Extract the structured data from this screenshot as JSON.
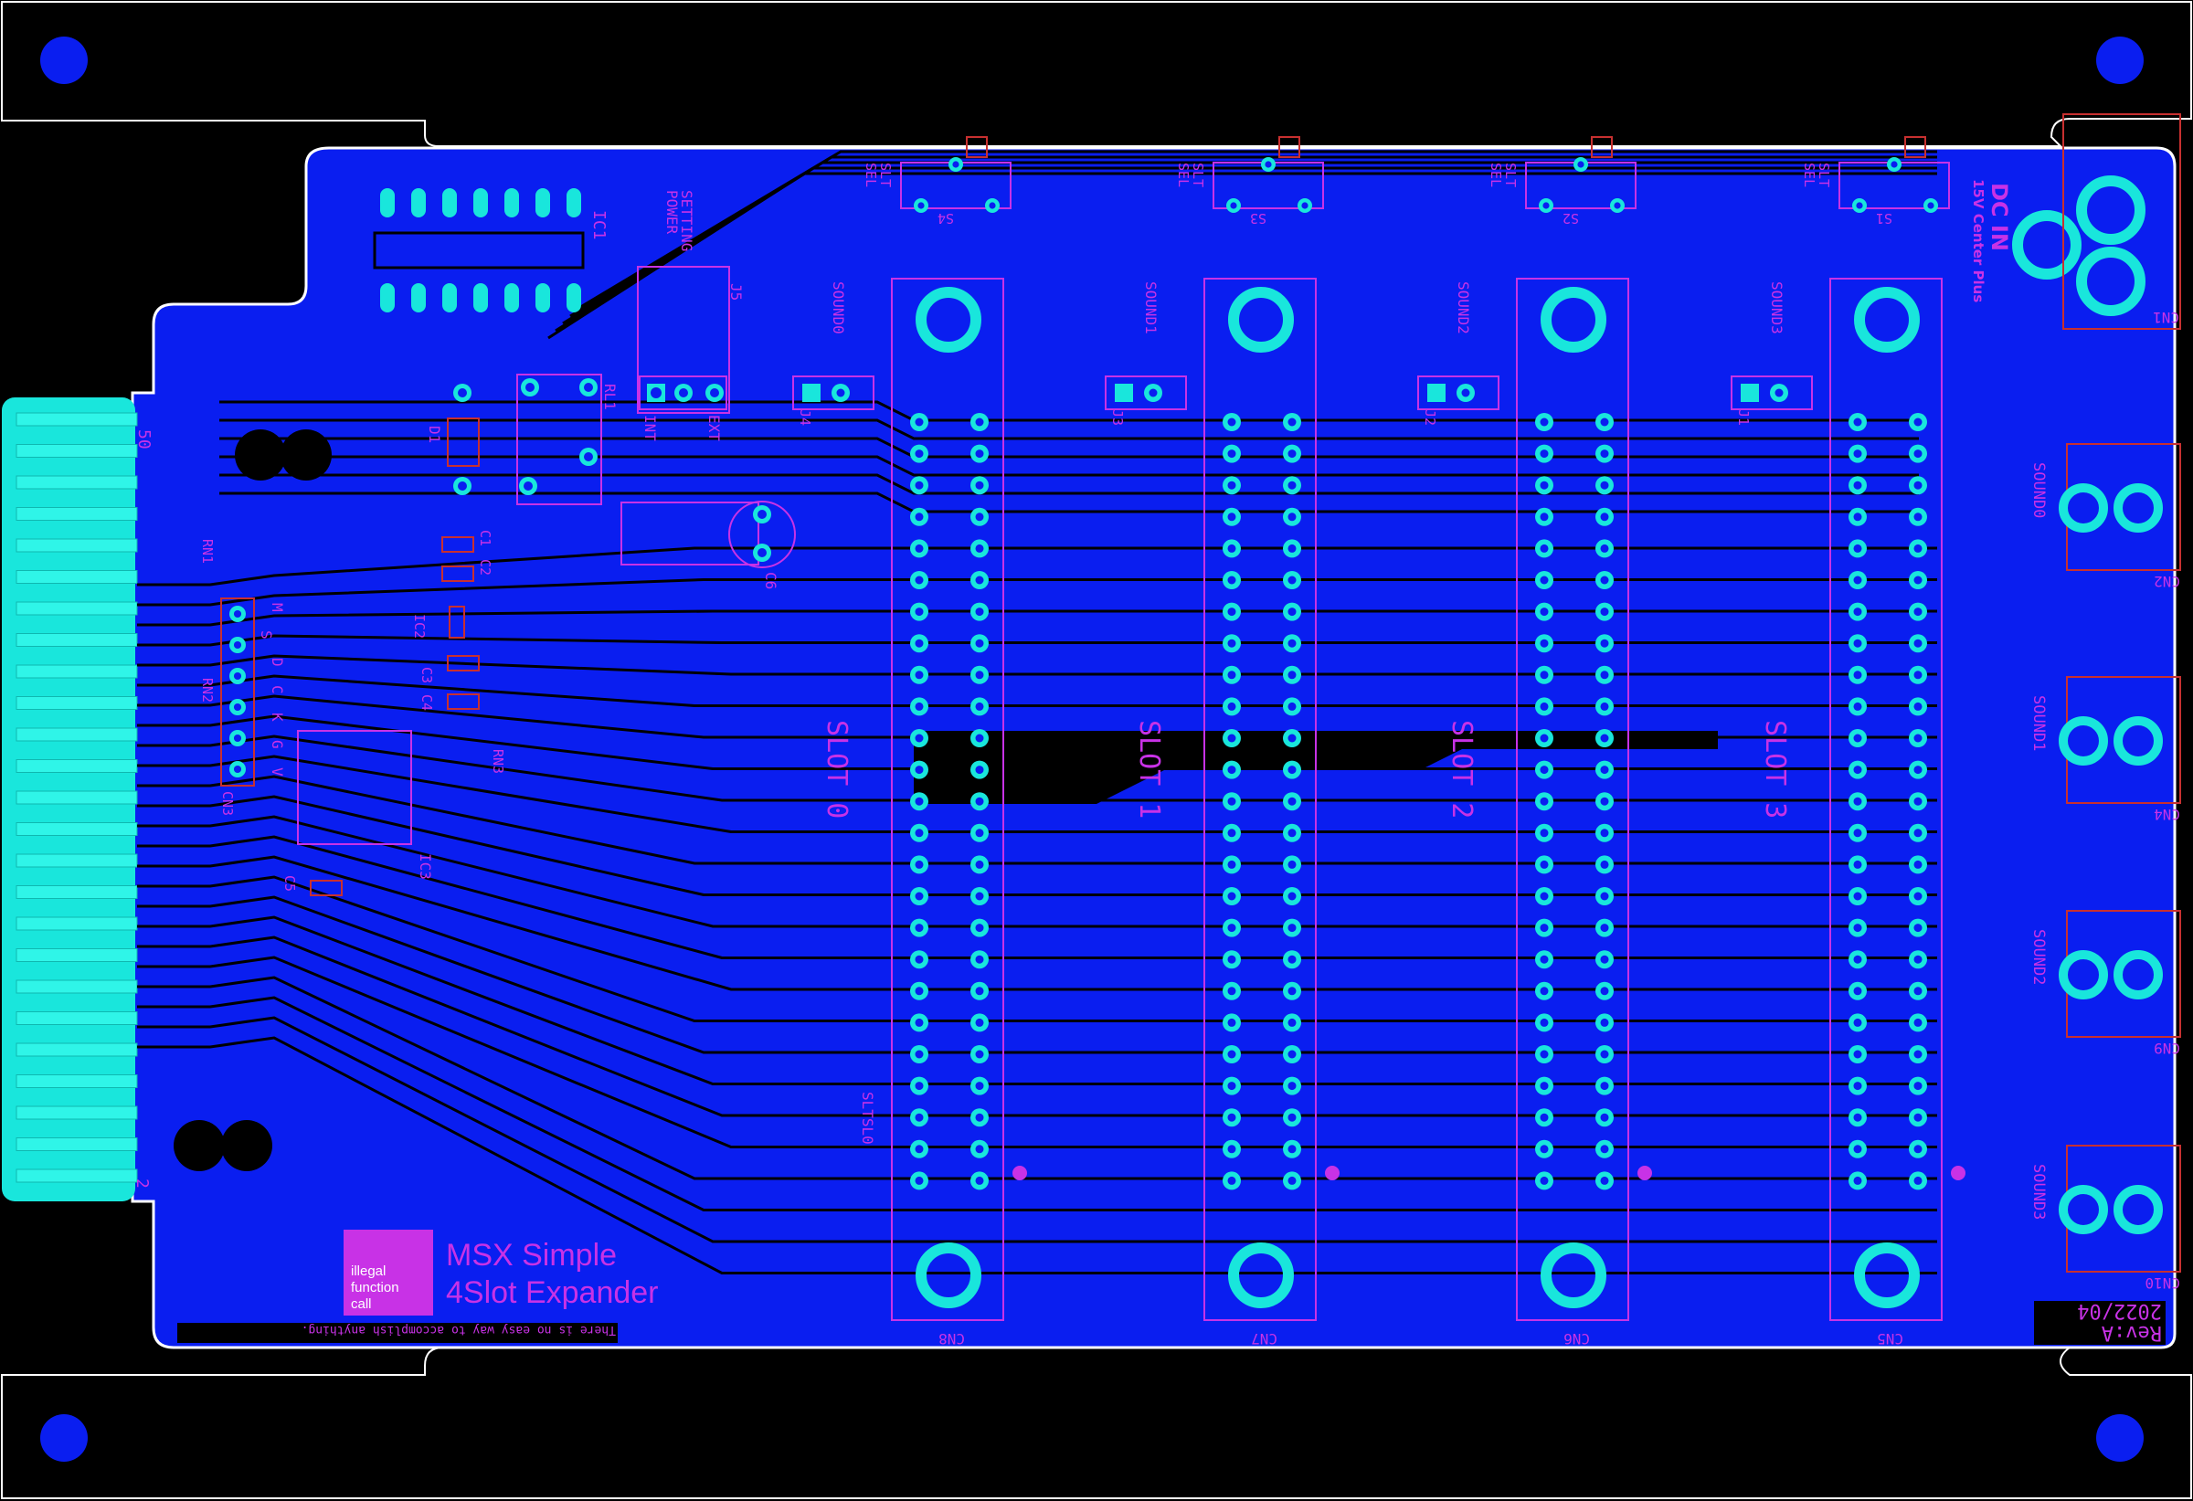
{
  "board": {
    "title_line1": "MSX Simple",
    "title_line2": "4Slot Expander",
    "logo_lines": [
      "illegal",
      "function",
      "call"
    ],
    "motto": "There is no easy way to accomplish anything.",
    "date": "2022/04",
    "revision": "Rev:A",
    "dc_in": "DC IN",
    "dc_polarity": "15V Center Plus",
    "power_setting": "POWER\nSETTING",
    "edge_pin_50": "50",
    "edge_pin_2": "2",
    "sltsl0": "SLTSL0",
    "pin_header_letters": [
      "M",
      "S",
      "D",
      "C",
      "K",
      "G",
      "V"
    ]
  },
  "slots": [
    {
      "label": "SLOT 0",
      "connector": "CN8",
      "sound": "SOUND0",
      "jumper": "J4",
      "switch": "S4",
      "sel": "SLT SEL"
    },
    {
      "label": "SLOT 1",
      "connector": "CN7",
      "sound": "SOUND1",
      "jumper": "J3",
      "switch": "S3",
      "sel": "SLT SEL"
    },
    {
      "label": "SLOT 2",
      "connector": "CN6",
      "sound": "SOUND2",
      "jumper": "J2",
      "switch": "S2",
      "sel": "SLT SEL"
    },
    {
      "label": "SLOT 3",
      "connector": "CN5",
      "sound": "SOUND3",
      "jumper": "J1",
      "switch": "S1",
      "sel": "SLT SEL"
    }
  ],
  "audio_outputs": [
    {
      "label": "SOUND0",
      "connector": "CN2"
    },
    {
      "label": "SOUND1",
      "connector": "CN4"
    },
    {
      "label": "SOUND2",
      "connector": "CN9"
    },
    {
      "label": "SOUND3",
      "connector": "CN10"
    }
  ],
  "components": {
    "ic1": "IC1",
    "ic2": "IC2",
    "ic3": "IC3",
    "rl1": "RL1",
    "d1": "D1",
    "j5": "J5",
    "int": "INT",
    "ext": "EXT",
    "c1": "C1",
    "c2": "C2",
    "c3": "C3",
    "c4": "C4",
    "c5": "C5",
    "c6": "C6",
    "rn1": "RN1",
    "rn2": "RN2",
    "rn3": "RN3",
    "cn1": "CN1",
    "cn3": "CN3"
  },
  "colors": {
    "board": "#0a1ef0",
    "pad": "#19e6dc",
    "silkscreen": "#c832e6",
    "trace": "#000000",
    "outline": "#ffffff",
    "mount_hole": "#0a1ef0"
  }
}
